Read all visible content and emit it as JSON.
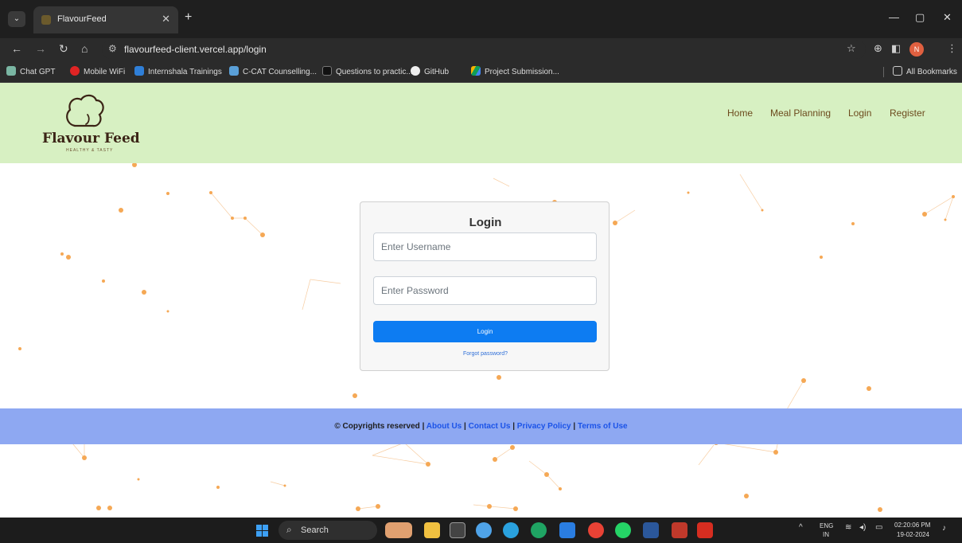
{
  "browser": {
    "tab_title": "FlavourFeed",
    "url": "flavourfeed-client.vercel.app/login",
    "profile_initial": "N",
    "bookmarks": [
      "Chat GPT",
      "Mobile WiFi",
      "Internshala Trainings",
      "C-CAT Counselling...",
      "Questions to practic...",
      "GitHub",
      "Project Submission..."
    ],
    "all_bookmarks": "All Bookmarks"
  },
  "site": {
    "brand": "Flavour Feed",
    "tagline": "HEALTHY & TASTY",
    "nav": [
      "Home",
      "Meal Planning",
      "Login",
      "Register"
    ]
  },
  "login": {
    "title": "Login",
    "username_placeholder": "Enter Username",
    "password_placeholder": "Enter Password",
    "button": "Login",
    "forgot": "Forgot password?"
  },
  "footer": {
    "copyright": "© Copyrights reserved",
    "sep": "|",
    "links": [
      "About Us",
      "Contact Us",
      "Privacy Policy",
      "Terms of Use"
    ]
  },
  "taskbar": {
    "search": "Search",
    "lang_top": "ENG",
    "lang_bottom": "IN",
    "time": "02:20:06 PM",
    "date": "19-02-2024"
  },
  "colors": {
    "header_bg": "#d7f0c2",
    "footer_bg": "#8ea8f2",
    "button": "#0d7cf2",
    "particle": "#f5a855"
  }
}
